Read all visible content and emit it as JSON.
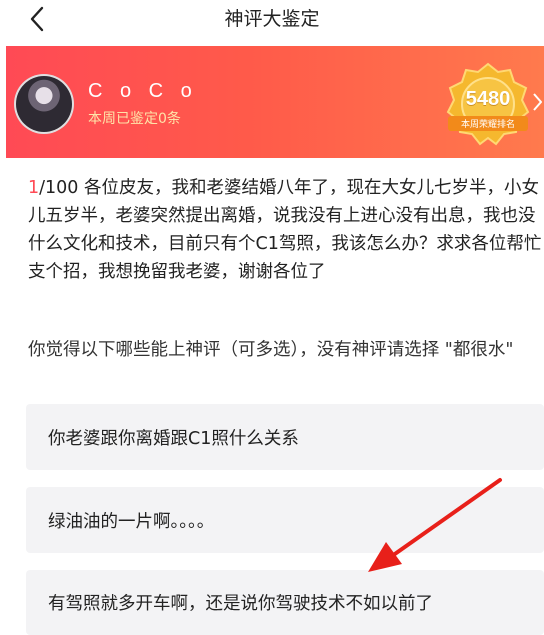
{
  "nav": {
    "title": "神评大鉴定"
  },
  "user": {
    "name": "C o C o",
    "subtitle": "本周已鉴定0条"
  },
  "badge": {
    "score": "5480",
    "label": "本周荣耀排名"
  },
  "question": {
    "index": "1",
    "total": "/100",
    "text": " 各位皮友，我和老婆结婚八年了，现在大女儿七岁半，小女儿五岁半，老婆突然提出离婚，说我没有上进心没有出息，我也没什么文化和技术，目前只有个C1驾照，我该怎么办？求求各位帮忙支个招，我想挽留我老婆，谢谢各位了"
  },
  "prompt": "你觉得以下哪些能上神评（可多选），没有神评请选择 \"都很水\"",
  "options": [
    {
      "label": "你老婆跟你离婚跟C1照什么关系"
    },
    {
      "label": "绿油油的一片啊。。。。"
    },
    {
      "label": "有驾照就多开车啊，还是说你驾驶技术不如以前了"
    }
  ],
  "colors": {
    "accent": "#ff4a55",
    "banner_start": "#ff4a55",
    "banner_end": "#ff7a4d",
    "badge_gold": "#f5b82e",
    "annotation_arrow": "#e8201a"
  },
  "icons": {
    "back": "chevron-left-icon",
    "badge": "gold-medal-icon"
  }
}
